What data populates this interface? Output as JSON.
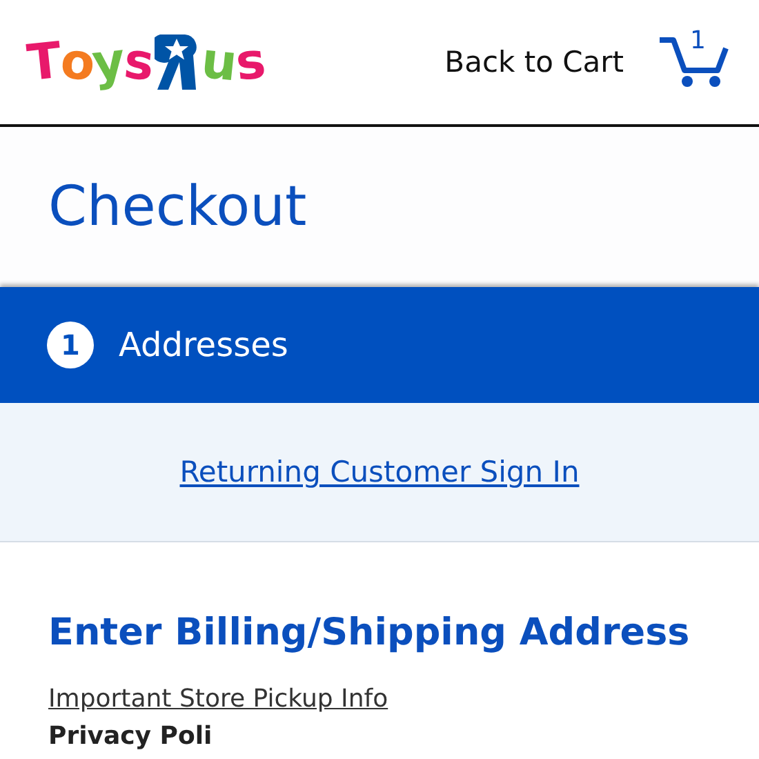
{
  "header": {
    "logo": [
      {
        "char": "T",
        "color": "#e8196b",
        "kind": "letter"
      },
      {
        "char": "o",
        "color": "#f47b20",
        "kind": "letter"
      },
      {
        "char": "y",
        "color": "#6cbe45",
        "kind": "letter"
      },
      {
        "char": "s",
        "color": "#e8196b",
        "kind": "letter"
      },
      {
        "color": "#0054a6",
        "kind": "mark"
      },
      {
        "char": "u",
        "color": "#6cbe45",
        "kind": "letter"
      },
      {
        "char": "s",
        "color": "#e8196b",
        "kind": "letter"
      }
    ],
    "back_link": "Back to Cart",
    "cart_count": "1"
  },
  "title": "Checkout",
  "step": {
    "number": "1",
    "label": "Addresses"
  },
  "sign_in_link": "Returning Customer Sign In",
  "section_title": "Enter Billing/Shipping Address",
  "pickup_link": "Important Store Pickup Info",
  "privacy_link": "Privacy Poli"
}
